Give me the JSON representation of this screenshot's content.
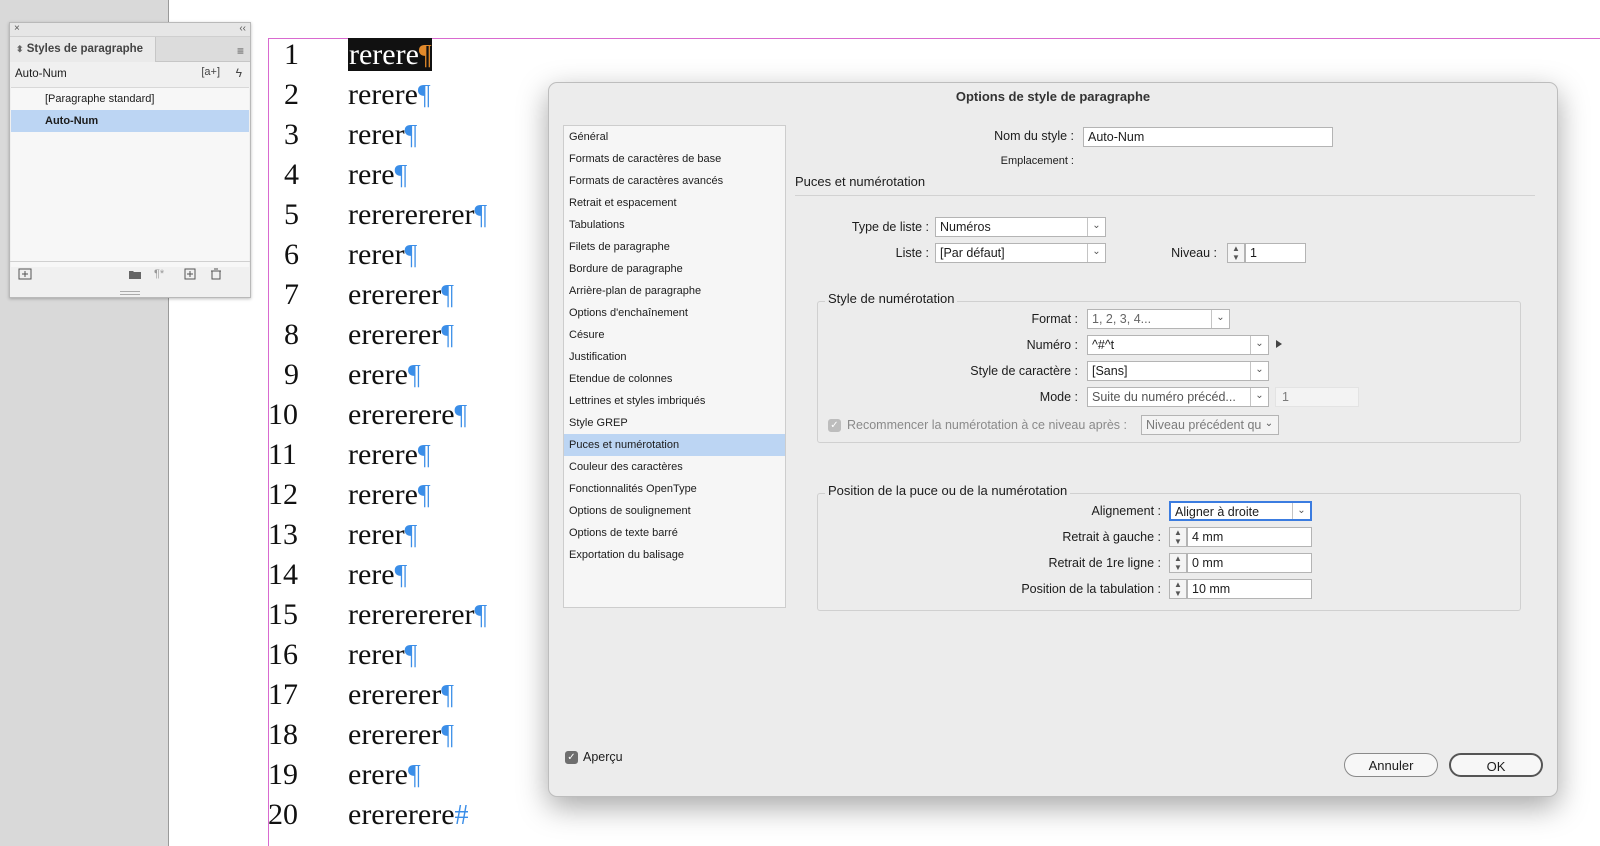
{
  "panel": {
    "close_glyph": "×",
    "collapse_glyph": "‹‹",
    "tab_label": "Styles de paragraphe",
    "current_style": "Auto-Num",
    "new_style_glyph": "[a+]",
    "quick_apply_glyph": "ϟ",
    "menu_glyph": "≡",
    "items": [
      {
        "label": "[Paragraphe standard]",
        "selected": false
      },
      {
        "label": "Auto-Num",
        "selected": true
      }
    ],
    "bottom_icons": [
      "import-icon",
      "folder-icon",
      "clear-override-icon",
      "new-style-icon",
      "trash-icon"
    ]
  },
  "document": {
    "pilcrow": "¶",
    "end_mark": "#",
    "lines": [
      {
        "num": "1",
        "text": "rerere",
        "highlight": true
      },
      {
        "num": "2",
        "text": "rerere"
      },
      {
        "num": "3",
        "text": "rerer"
      },
      {
        "num": "4",
        "text": "rere"
      },
      {
        "num": "5",
        "text": "rererererer"
      },
      {
        "num": "6",
        "text": "rerer"
      },
      {
        "num": "7",
        "text": "erererer"
      },
      {
        "num": "8",
        "text": "erererer"
      },
      {
        "num": "9",
        "text": "erere"
      },
      {
        "num": "10",
        "text": "erererere"
      },
      {
        "num": "11",
        "text": "rerere"
      },
      {
        "num": "12",
        "text": "rerere"
      },
      {
        "num": "13",
        "text": "rerer"
      },
      {
        "num": "14",
        "text": "rere"
      },
      {
        "num": "15",
        "text": "rererererer"
      },
      {
        "num": "16",
        "text": "rerer"
      },
      {
        "num": "17",
        "text": "erererer"
      },
      {
        "num": "18",
        "text": "erererer"
      },
      {
        "num": "19",
        "text": "erere"
      },
      {
        "num": "20",
        "text": "erererere",
        "end": true
      }
    ]
  },
  "dialog": {
    "title": "Options de style de paragraphe",
    "categories": [
      "Général",
      "Formats de caractères de base",
      "Formats de caractères avancés",
      "Retrait et espacement",
      "Tabulations",
      "Filets de paragraphe",
      "Bordure de paragraphe",
      "Arrière-plan de paragraphe",
      "Options d'enchaînement",
      "Césure",
      "Justification",
      "Etendue de colonnes",
      "Lettrines et styles imbriqués",
      "Style GREP",
      "Puces et numérotation",
      "Couleur des caractères",
      "Fonctionnalités OpenType",
      "Options de soulignement",
      "Options de texte barré",
      "Exportation du balisage"
    ],
    "selected_category": "Puces et numérotation",
    "style_name_label": "Nom du style :",
    "style_name_value": "Auto-Num",
    "location_label": "Emplacement :",
    "section_title": "Puces et numérotation",
    "list_type_label": "Type de liste :",
    "list_type_value": "Numéros",
    "list_label": "Liste :",
    "list_value": "[Par défaut]",
    "level_label": "Niveau :",
    "level_value": "1",
    "numbering_style": {
      "title": "Style de numérotation",
      "format_label": "Format :",
      "format_value": "1, 2, 3, 4...",
      "number_label": "Numéro :",
      "number_value": "^#^t",
      "char_style_label": "Style de caractère :",
      "char_style_value": "[Sans]",
      "mode_label": "Mode :",
      "mode_value": "Suite du numéro précéd...",
      "mode_start_value": "1",
      "restart_label": "Recommencer la numérotation à ce niveau après :",
      "restart_value": "Niveau précédent qu",
      "restart_checked": true
    },
    "position": {
      "title": "Position de la puce ou de la numérotation",
      "alignment_label": "Alignement :",
      "alignment_value": "Aligner à droite",
      "left_indent_label": "Retrait à gauche :",
      "left_indent_value": "4 mm",
      "first_indent_label": "Retrait de 1re ligne :",
      "first_indent_value": "0 mm",
      "tab_position_label": "Position de la tabulation :",
      "tab_position_value": "10 mm"
    },
    "preview_label": "Aperçu",
    "preview_checked": true,
    "cancel_label": "Annuler",
    "ok_label": "OK"
  }
}
